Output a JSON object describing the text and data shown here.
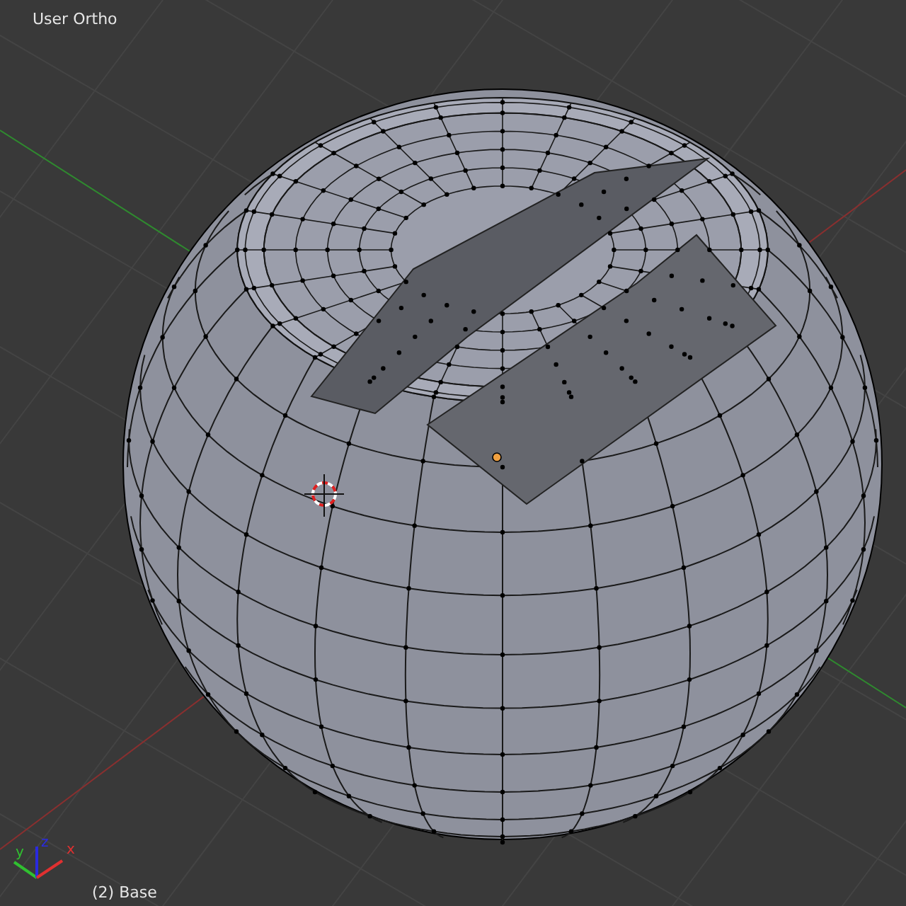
{
  "viewport": {
    "title": "User Ortho",
    "object_label": "(2) Base",
    "axes": [
      {
        "label": "y",
        "color": "#30c030"
      },
      {
        "label": "z",
        "color": "#2a2ae0"
      },
      {
        "label": "x",
        "color": "#e03030"
      }
    ]
  }
}
